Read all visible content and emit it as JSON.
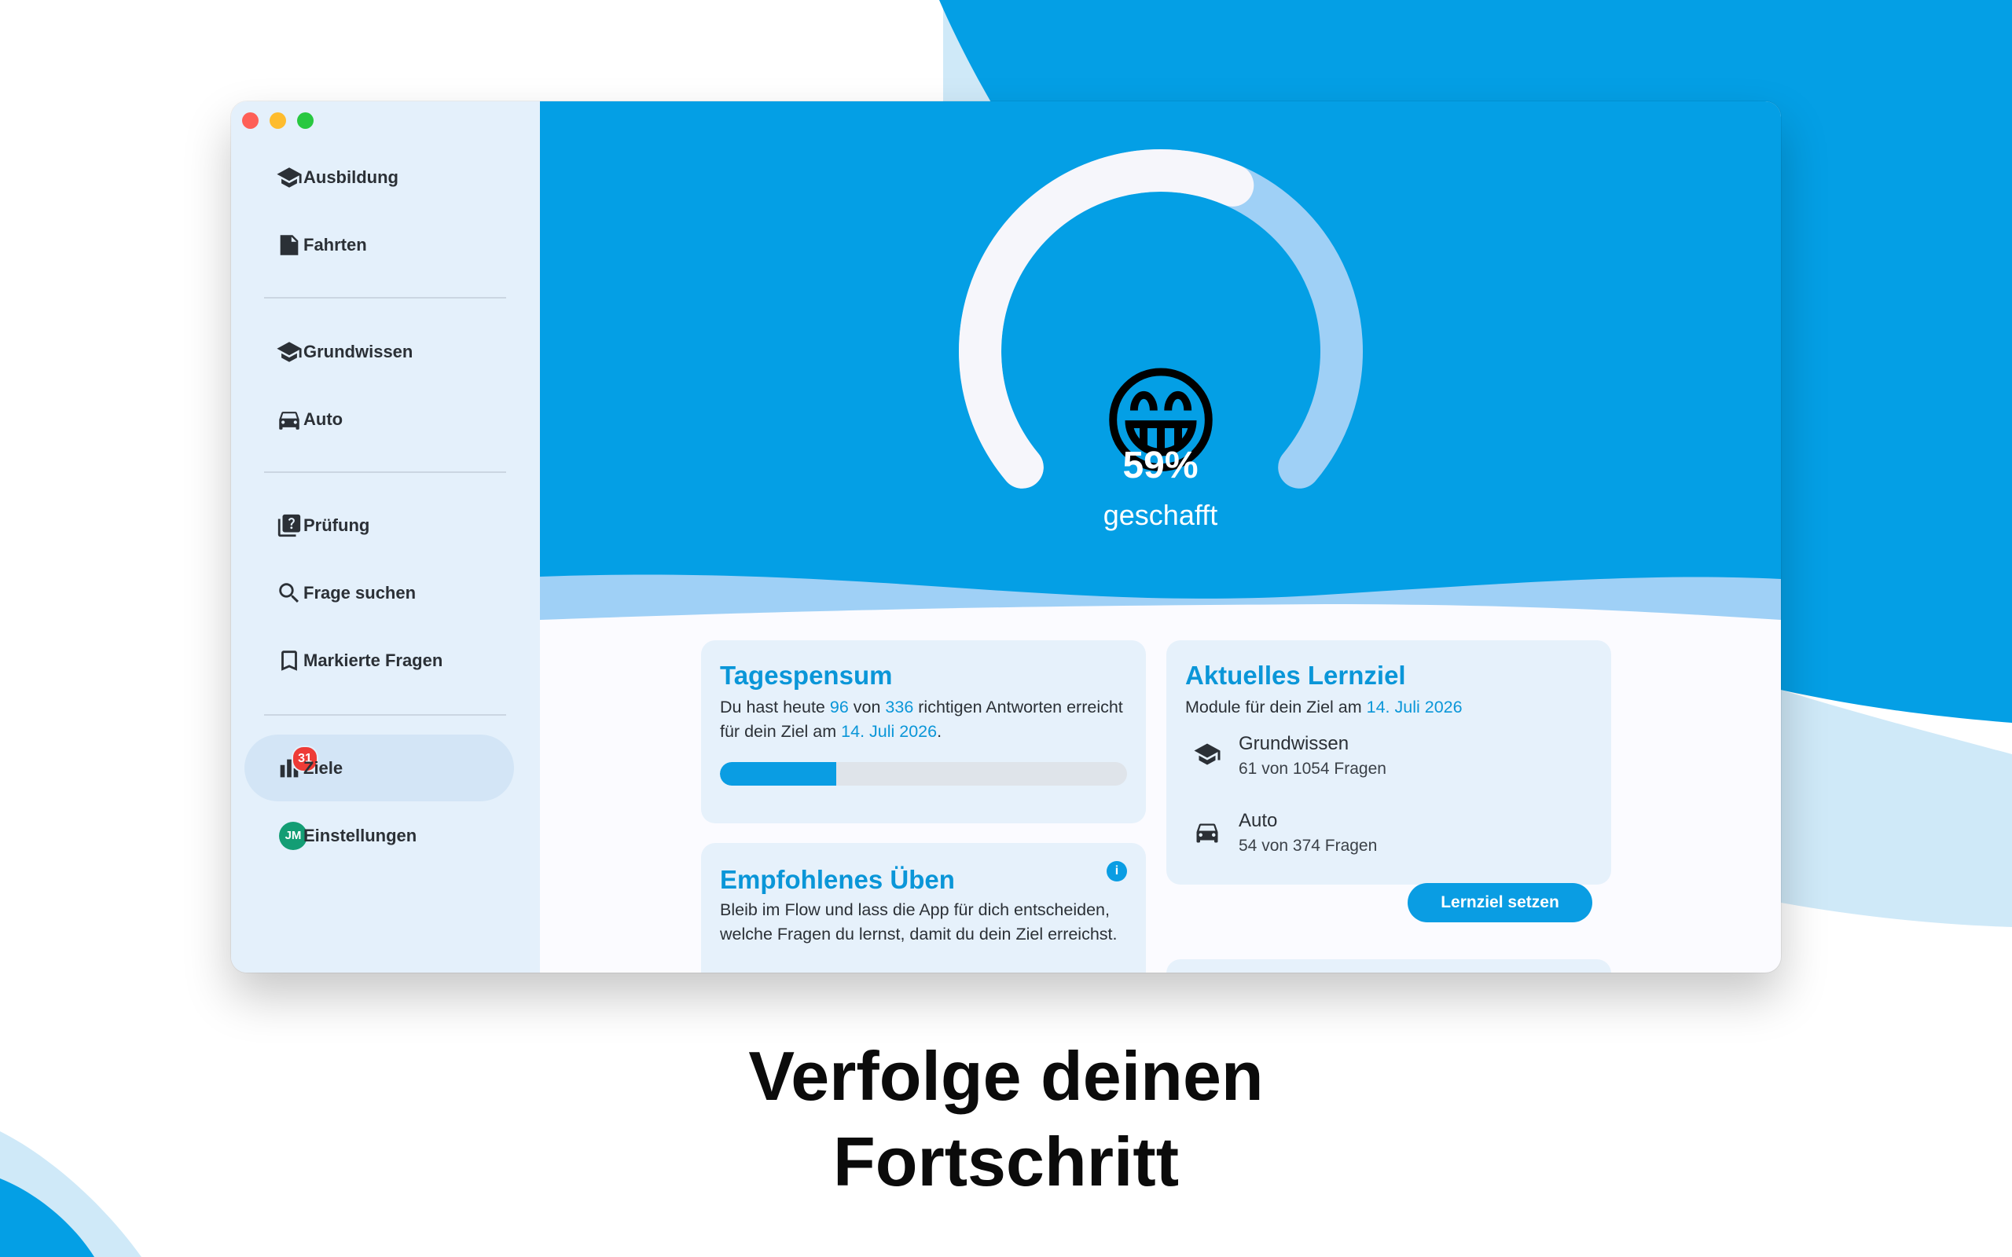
{
  "colors": {
    "brand_blue": "#0a9de3",
    "hero_blue": "#049fe5",
    "light_blue": "#9fd0f6",
    "sidebar_bg": "#e4f0fb",
    "badge_red": "#ee3b36",
    "avatar_green": "#139d74"
  },
  "sidebar": {
    "items": [
      {
        "label": "Ausbildung",
        "icon": "graduation-cap-icon"
      },
      {
        "label": "Fahrten",
        "icon": "document-icon"
      },
      {
        "label": "Grundwissen",
        "icon": "graduation-cap-icon"
      },
      {
        "label": "Auto",
        "icon": "car-icon"
      },
      {
        "label": "Prüfung",
        "icon": "question-book-icon"
      },
      {
        "label": "Frage suchen",
        "icon": "search-icon"
      },
      {
        "label": "Markierte Fragen",
        "icon": "bookmark-icon"
      },
      {
        "label": "Ziele",
        "icon": "bar-chart-icon",
        "badge": "31",
        "active": true
      },
      {
        "label": "Einstellungen",
        "icon": "avatar",
        "avatar_initials": "JM"
      }
    ]
  },
  "gauge": {
    "percent_value": 0.59,
    "percent_text": "59%",
    "label": "geschafft",
    "emoji": "😁"
  },
  "tagespensum": {
    "title": "Tagespensum",
    "text_1": "Du hast heute ",
    "today": "96",
    "text_2": " von ",
    "total": "336",
    "text_3": " richtigen Antworten erreicht für dein Ziel am ",
    "date": "14. Juli 2026",
    "text_4": ".",
    "progress_fraction": 0.286
  },
  "empfohlen": {
    "title": "Empfohlenes Üben",
    "text": "Bleib im Flow und lass die App für dich entscheiden, welche Fragen du lernst, damit du dein Ziel erreichst.",
    "info_glyph": "i"
  },
  "lernziel": {
    "title": "Aktuelles Lernziel",
    "subtitle_1": "Module für dein Ziel am ",
    "date": "14. Juli 2026",
    "modules": [
      {
        "name": "Grundwissen",
        "sub": "61 von 1054 Fragen",
        "icon": "graduation-cap-icon"
      },
      {
        "name": "Auto",
        "sub": "54 von 374 Fragen",
        "icon": "car-icon"
      }
    ],
    "button": "Lernziel setzen"
  },
  "caption": {
    "line1": "Verfolge deinen",
    "line2": "Fortschritt"
  }
}
